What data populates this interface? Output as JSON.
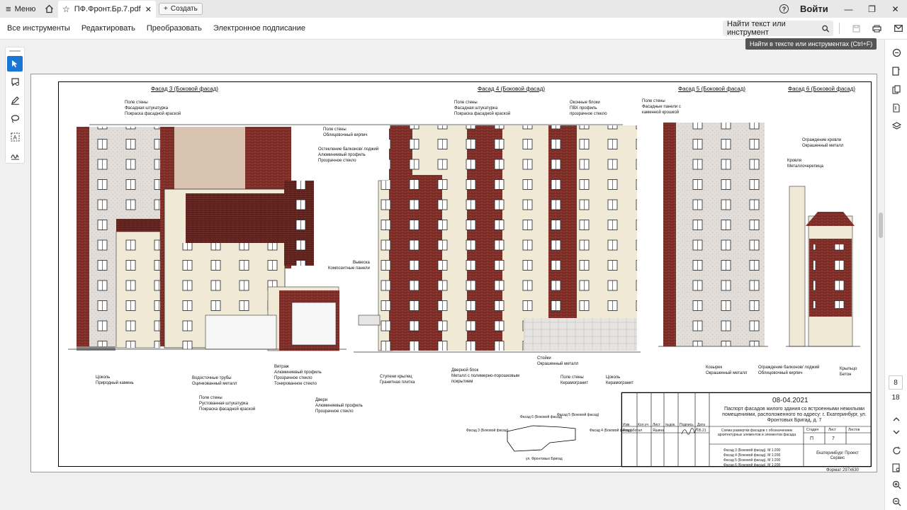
{
  "titlebar": {
    "menu_label": "Меню",
    "tab_title": "ПФ.Фронт.Бр.7.pdf",
    "new_tab_label": "Создать",
    "signin_label": "Войти"
  },
  "toolbar": {
    "items": [
      "Все инструменты",
      "Редактировать",
      "Преобразовать",
      "Электронное подписание"
    ],
    "search_label": "Найти текст или инструмент",
    "tooltip": "Найти в тексте или инструментах (Ctrl+F)"
  },
  "pager": {
    "current": "8",
    "total": "18"
  },
  "colors": {
    "accent": "#1976d2",
    "brick": "#7a2a24",
    "stucco": "#efe9d6"
  },
  "drawing": {
    "facade_titles": [
      "Фасад 3 (Боковой фасад)",
      "Фасад 4 (Боковой фасад)",
      "Фасад 5 (Боковой фасад)",
      "Фасад 6 (Боковой фасад)"
    ],
    "annotations": [
      {
        "lines": [
          "Поле стены",
          "Фасадная штукатурка",
          "Покраска фасадной краской"
        ]
      },
      {
        "lines": [
          "Поле стены",
          "Облицовочный кирпич"
        ]
      },
      {
        "lines": [
          "Остекление балконов/ лоджий",
          "Алюминиевый профиль",
          "Прозрачное стекло"
        ]
      },
      {
        "lines": [
          "Поле стены",
          "Фасадная штукатурка",
          "Покраска фасадной краской"
        ]
      },
      {
        "lines": [
          "Оконные блоки",
          "ПВХ профиль",
          "прозрачное стекло"
        ]
      },
      {
        "lines": [
          "Поле стены",
          "Фасадные панели с",
          "каменной крошкой"
        ]
      },
      {
        "lines": [
          "Ограждение кровли",
          "Окрашенный металл"
        ]
      },
      {
        "lines": [
          "Кровля",
          "Металлочерепица"
        ]
      },
      {
        "lines": [
          "Вывеска",
          "Композитные панели"
        ]
      },
      {
        "lines": [
          "Цоколь",
          "Природный камень"
        ]
      },
      {
        "lines": [
          "Водосточные трубы",
          "Оцинкованный металл"
        ]
      },
      {
        "lines": [
          "Витраж",
          "Алюминиевый профиль",
          "Прозрачное стекло",
          "Тонированное стекло"
        ]
      },
      {
        "lines": [
          "Поле стены",
          "Рустованная штукатурка",
          "Покраска фасадной краской"
        ]
      },
      {
        "lines": [
          "Двери",
          "Алюминиевый профиль",
          "Прозрачное стекло"
        ]
      },
      {
        "lines": [
          "Ступени крылец",
          "Гранитная плитка"
        ]
      },
      {
        "lines": [
          "Дверной блок",
          "Металл с полимерно-порошковым",
          "покрытием"
        ]
      },
      {
        "lines": [
          "Стойки",
          "Окрашенный металл"
        ]
      },
      {
        "lines": [
          "Поле стены",
          "Керамогранит"
        ]
      },
      {
        "lines": [
          "Цоколь",
          "Керамогранит"
        ]
      },
      {
        "lines": [
          "Козырек",
          "Окрашенный металл"
        ]
      },
      {
        "lines": [
          "Ограждение балконов/ лоджий",
          "Облицовочный кирпич"
        ]
      },
      {
        "lines": [
          "Крыльцо",
          "Бетон"
        ]
      }
    ],
    "stamp": {
      "date": "08-04.2021",
      "project_name": "Паспорт фасадов жилого здания со встроенными нежилыми помещениями, расположенного по адресу: г. Екатеринбург, ул. Фронтовых Бригад, д. 7",
      "headers": [
        "Изм.",
        "Кол.уч",
        "Лист",
        "№док.",
        "Подпись",
        "Дата"
      ],
      "role": "Разработал",
      "person": "Яшина",
      "sign_date": "05.21",
      "sheet_title": "Схема развертки фасадов с обозначением архитектурных элементов и элементов фасада",
      "stage_headers": [
        "Стадия",
        "Лист",
        "Листов"
      ],
      "stage": "П",
      "sheet": "7",
      "contents": [
        "Фасад 3 (Боковой фасад). М 1:200",
        "Фасад 4 (Боковой фасад). М 1:200",
        "Фасад 5 (Боковой фасад). М 1:200",
        "Фасад 6 (Боковой фасад). М 1:200"
      ],
      "company": "ЕкатеринБург Проект Сервис",
      "format": "Формат 297х630"
    },
    "keyplan": {
      "labels": [
        "Фасад 6 (Боковой фасад)",
        "Фасад 5 (Боковой фасад)",
        "Фасад 3 (Боковой фасад)",
        "Фасад 4 (Боковой фасад)"
      ],
      "street": "ул. Фронтовых Бригад"
    }
  }
}
